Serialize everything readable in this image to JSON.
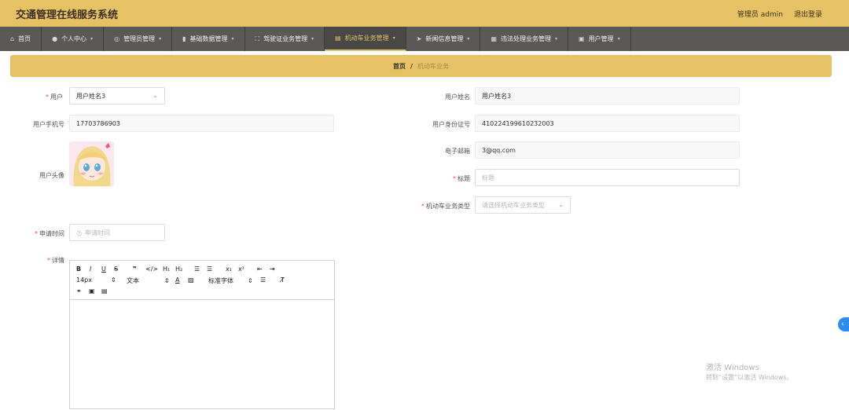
{
  "header": {
    "title": "交通管理在线服务系统",
    "user_label": "管理员 admin",
    "logout_label": "退出登录"
  },
  "nav": [
    {
      "label": "首页",
      "icon": "home-icon",
      "dropdown": false
    },
    {
      "label": "个人中心",
      "icon": "user-icon",
      "dropdown": true
    },
    {
      "label": "管理员管理",
      "icon": "globe-icon",
      "dropdown": true
    },
    {
      "label": "基础数据管理",
      "icon": "bar-chart-icon",
      "dropdown": true
    },
    {
      "label": "驾驶证业务管理",
      "icon": "expand-icon",
      "dropdown": true
    },
    {
      "label": "机动车业务管理",
      "icon": "id-card-icon",
      "dropdown": true,
      "active": true
    },
    {
      "label": "新闻信息管理",
      "icon": "send-icon",
      "dropdown": true
    },
    {
      "label": "违法处理业务管理",
      "icon": "grid-icon",
      "dropdown": true
    },
    {
      "label": "用户管理",
      "icon": "document-icon",
      "dropdown": true
    }
  ],
  "breadcrumb": {
    "home": "首页",
    "sep": "/",
    "current": "机动车业务"
  },
  "form": {
    "user": {
      "label": "用户",
      "value": "用户姓名3"
    },
    "user_name": {
      "label": "用户姓名",
      "value": "用户姓名3"
    },
    "phone": {
      "label": "用户手机号",
      "value": "17703786903"
    },
    "id_number": {
      "label": "用户身份证号",
      "value": "410224199610232003"
    },
    "email": {
      "label": "电子邮箱",
      "value": "3@qq.com"
    },
    "avatar": {
      "label": "用户头像"
    },
    "title": {
      "label": "标题",
      "placeholder": "标题"
    },
    "biz_type": {
      "label": "机动车业务类型",
      "placeholder": "请选择机动车业务类型"
    },
    "apply_time": {
      "label": "申请时间",
      "placeholder": "申请时间"
    },
    "detail": {
      "label": "详情"
    }
  },
  "editor_toolbar": {
    "font_size": "14px",
    "text_style": "文本",
    "font_family": "标准字体"
  },
  "watermark": {
    "line1": "激活 Windows",
    "line2": "转到“设置”以激活 Windows。"
  },
  "colors": {
    "accent": "#e6c264",
    "nav_bg": "#5b5956",
    "required": "#e05050"
  }
}
